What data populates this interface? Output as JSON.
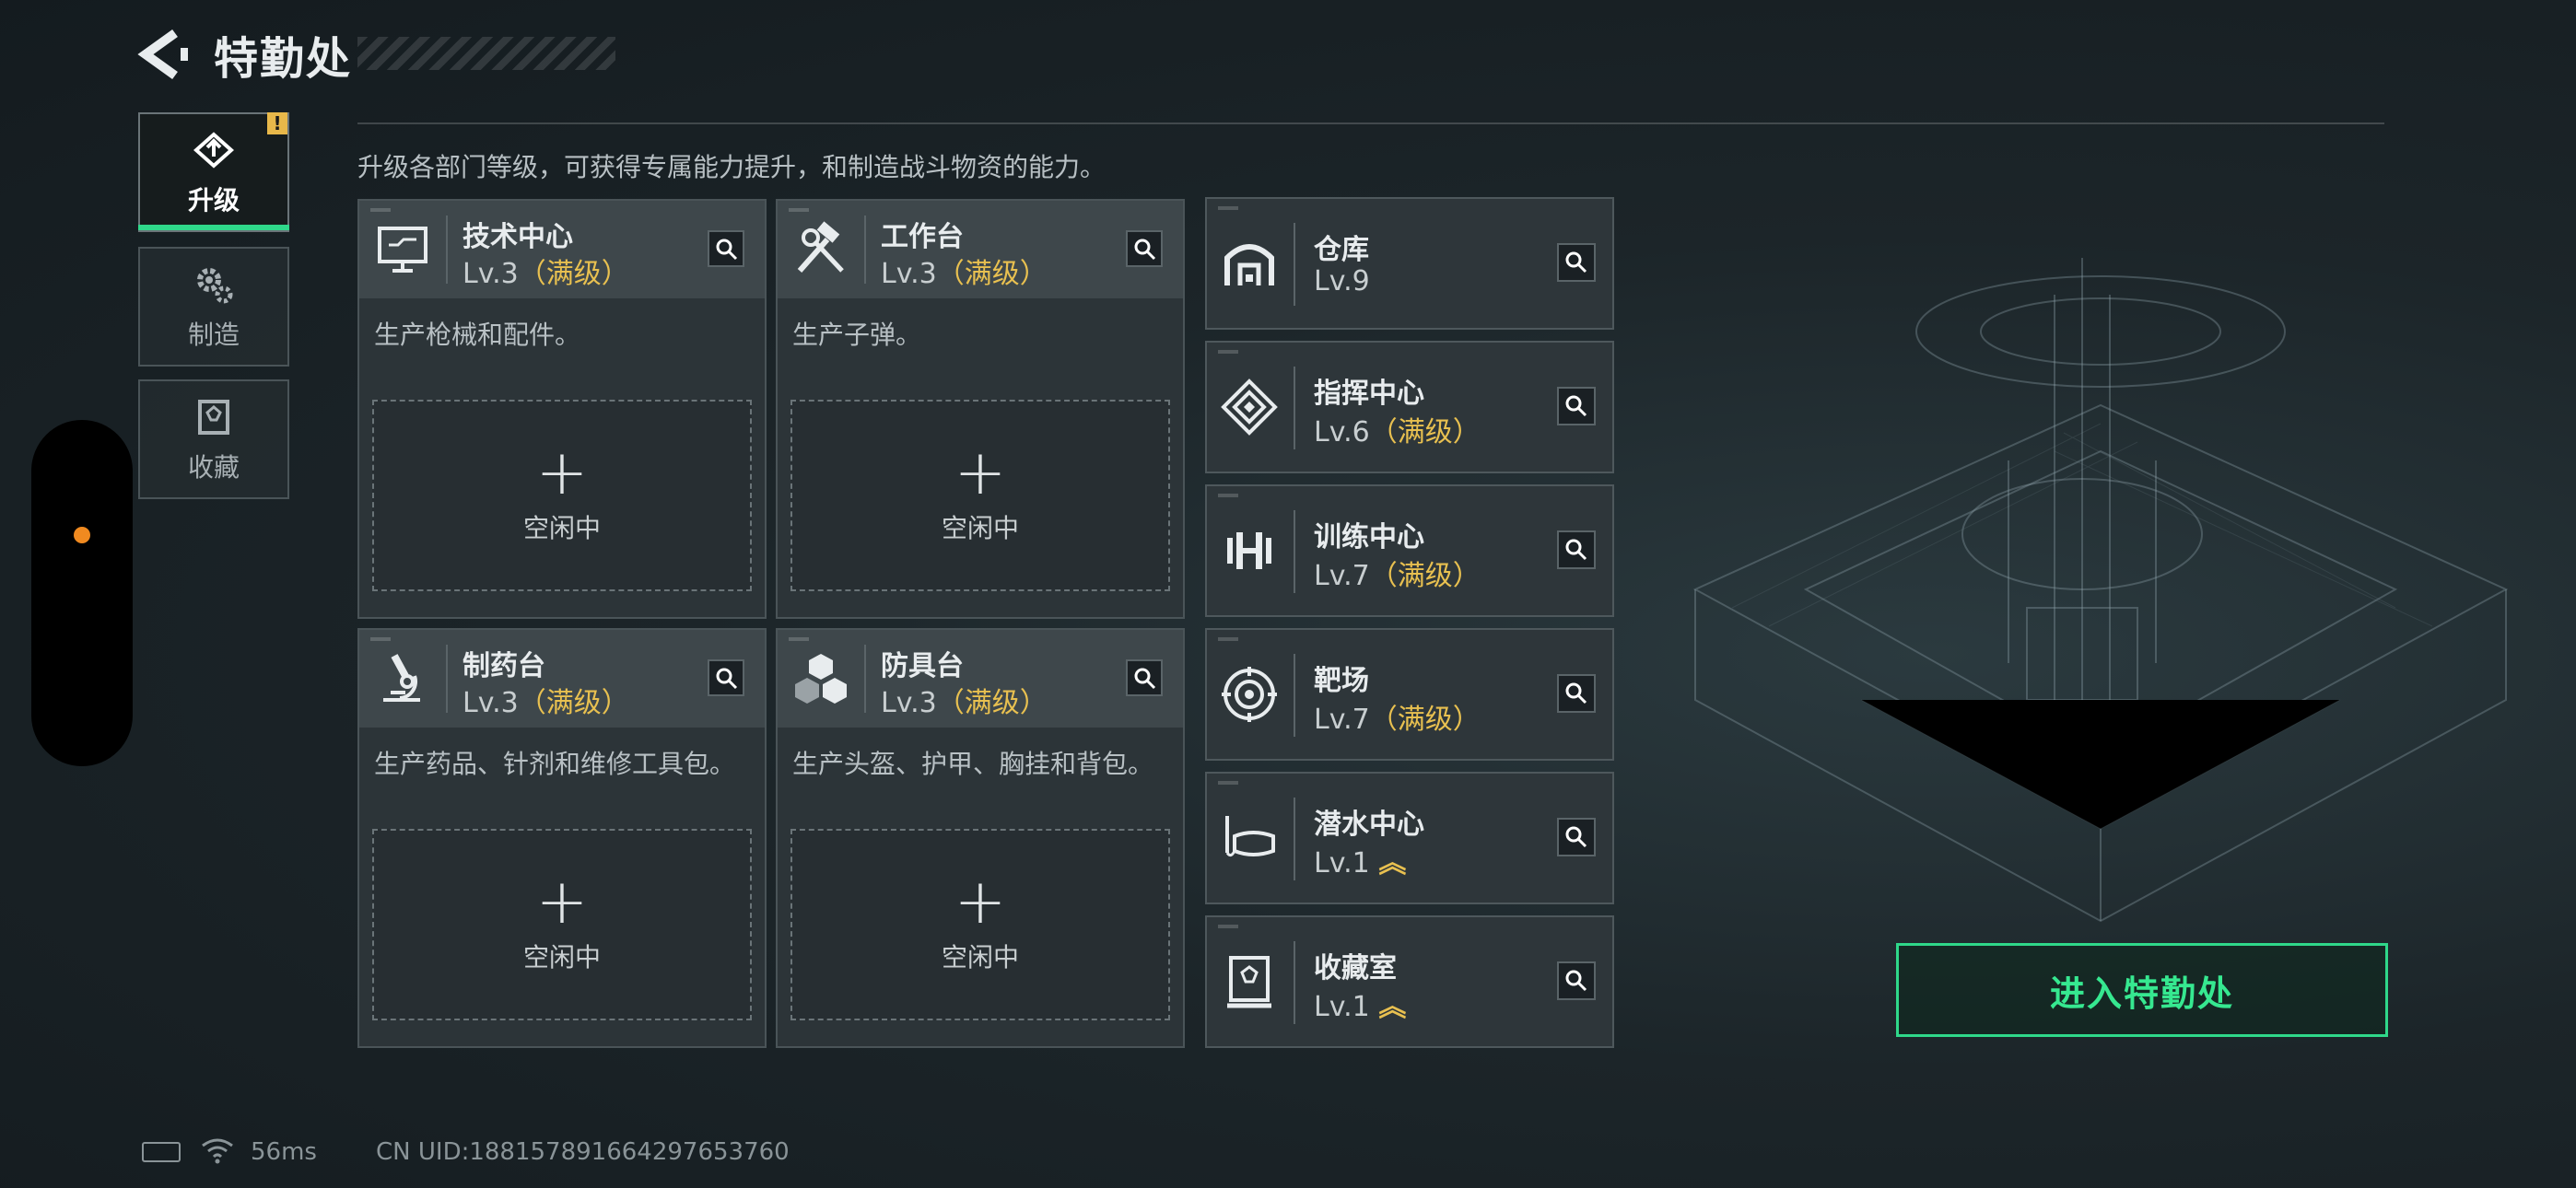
{
  "header": {
    "title": "特勤处"
  },
  "nav": [
    {
      "label": "升级",
      "icon": "upgrade-icon",
      "active": true,
      "badge": "!"
    },
    {
      "label": "制造",
      "icon": "gears-icon",
      "active": false
    },
    {
      "label": "收藏",
      "icon": "collection-icon",
      "active": false
    }
  ],
  "description": "升级各部门等级，可获得专属能力提升，和制造战斗物资的能力。",
  "cards": [
    {
      "name": "技术中心",
      "level": "Lv.3",
      "max": "（满级）",
      "desc": "生产枪械和配件。",
      "slot_plus": "+",
      "slot_status": "空闲中"
    },
    {
      "name": "工作台",
      "level": "Lv.3",
      "max": "（满级）",
      "desc": "生产子弹。",
      "slot_plus": "+",
      "slot_status": "空闲中"
    },
    {
      "name": "制药台",
      "level": "Lv.3",
      "max": "（满级）",
      "desc": "生产药品、针剂和维修工具包。",
      "slot_plus": "+",
      "slot_status": "空闲中"
    },
    {
      "name": "防具台",
      "level": "Lv.3",
      "max": "（满级）",
      "desc": "生产头盔、护甲、胸挂和背包。",
      "slot_plus": "+",
      "slot_status": "空闲中"
    }
  ],
  "facilities": [
    {
      "name": "仓库",
      "level": "Lv.9",
      "max": ""
    },
    {
      "name": "指挥中心",
      "level": "Lv.6",
      "max": "（满级）"
    },
    {
      "name": "训练中心",
      "level": "Lv.7",
      "max": "（满级）"
    },
    {
      "name": "靶场",
      "level": "Lv.7",
      "max": "（满级）"
    },
    {
      "name": "潜水中心",
      "level": "Lv.1",
      "up": "︽"
    },
    {
      "name": "收藏室",
      "level": "Lv.1",
      "up": "︽"
    }
  ],
  "enter_button": "进入特勤处",
  "footer": {
    "ping": "56ms",
    "uid": "CN UID:188157891664297653760"
  },
  "colors": {
    "accent": "#2fd88a",
    "max_level": "#e8c050",
    "warning": "#e8b84a",
    "background": "#1c2529"
  }
}
